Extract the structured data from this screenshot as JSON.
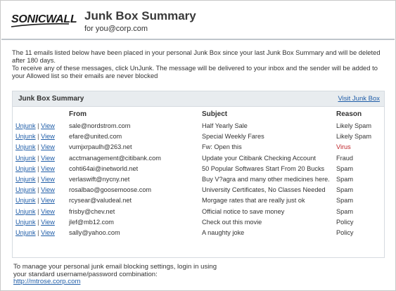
{
  "colors": {
    "link": "#1f5da8",
    "virus": "#c0282d",
    "panel_header_bg": "#e8ecef",
    "divider": "#bfc5cb"
  },
  "header": {
    "logo_text": "SONICWALL",
    "title": "Junk Box Summary",
    "subtitle": "for you@corp.com"
  },
  "intro": {
    "line1": "The 11 emails listed below have been placed in your personal Junk Box since your last Junk Box Summary and will be deleted after 180 days.",
    "line2": "To receive any of these messages, click UnJunk. The message will be delivered to your inbox and the sender will be added to your Allowed list so their emails are never blocked"
  },
  "panel": {
    "title": "Junk Box Summary",
    "visit_link": "Visit Junk Box",
    "columns": {
      "from": "From",
      "subject": "Subject",
      "reason": "Reason"
    },
    "unjunk_label": "Unjunk",
    "separator": "|",
    "view_label": "View",
    "rows": [
      {
        "from": "sale@nordstrom.com",
        "subject": "Half Yearly Sale",
        "reason": "Likely Spam"
      },
      {
        "from": "efare@united.com",
        "subject": "Special Weekly Fares",
        "reason": "Likely Spam"
      },
      {
        "from": "vumjxrpaulh@263.net",
        "subject": "Fw: Open this",
        "reason": "Virus"
      },
      {
        "from": "acctmanagement@citibank.com",
        "subject": "Update your Citibank Checking Account",
        "reason": "Fraud"
      },
      {
        "from": "cohti64ai@inetworld.net",
        "subject": "50 Popular Softwares Start From 20 Bucks",
        "reason": "Spam"
      },
      {
        "from": "verlaswift@nycny.net",
        "subject": "Buy V?agra and many other medicines here.",
        "reason": "Spam"
      },
      {
        "from": "rosalbao@goosemoose.com",
        "subject": "University Certificates, No Classes Needed",
        "reason": "Spam"
      },
      {
        "from": "rcysear@valudeal.net",
        "subject": "Morgage rates that are really just ok",
        "reason": "Spam"
      },
      {
        "from": "frisby@chev.net",
        "subject": "Official notice to save money",
        "reason": "Spam"
      },
      {
        "from": "jlef@mb12.com",
        "subject": "Check out this movie",
        "reason": "Policy"
      },
      {
        "from": "sally@yahoo.com",
        "subject": "A naughty joke",
        "reason": "Policy"
      }
    ]
  },
  "footer": {
    "line1": "To manage your personal junk email blocking settings, login in using",
    "line2": "your standard username/password combination:",
    "link": "http://mtrose.corp.com"
  }
}
